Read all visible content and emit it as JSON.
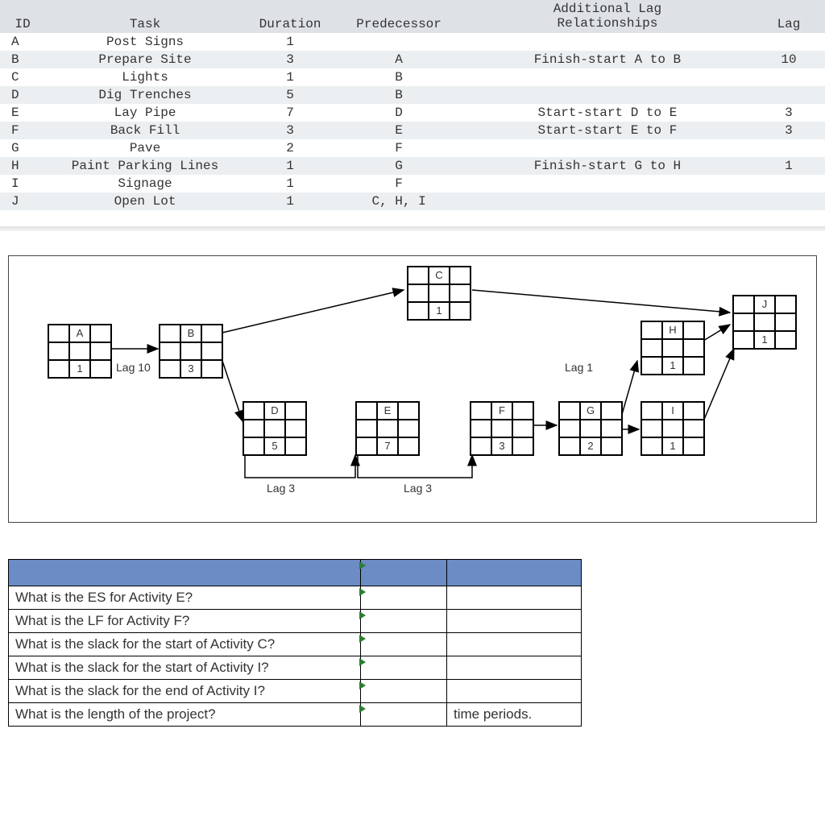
{
  "table": {
    "headers": {
      "id": "ID",
      "task": "Task",
      "duration": "Duration",
      "predecessor": "Predecessor",
      "lag_rel_line1": "Additional Lag",
      "lag_rel_line2": "Relationships",
      "lag": "Lag"
    },
    "rows": [
      {
        "id": "A",
        "task": "Post Signs",
        "duration": "1",
        "pred": "",
        "lag_rel": "",
        "lag": ""
      },
      {
        "id": "B",
        "task": "Prepare Site",
        "duration": "3",
        "pred": "A",
        "lag_rel": "Finish-start A to B",
        "lag": "10"
      },
      {
        "id": "C",
        "task": "Lights",
        "duration": "1",
        "pred": "B",
        "lag_rel": "",
        "lag": ""
      },
      {
        "id": "D",
        "task": "Dig Trenches",
        "duration": "5",
        "pred": "B",
        "lag_rel": "",
        "lag": ""
      },
      {
        "id": "E",
        "task": "Lay Pipe",
        "duration": "7",
        "pred": "D",
        "lag_rel": "Start-start D to E",
        "lag": "3"
      },
      {
        "id": "F",
        "task": "Back Fill",
        "duration": "3",
        "pred": "E",
        "lag_rel": "Start-start E to F",
        "lag": "3"
      },
      {
        "id": "G",
        "task": "Pave",
        "duration": "2",
        "pred": "F",
        "lag_rel": "",
        "lag": ""
      },
      {
        "id": "H",
        "task": "Paint Parking Lines",
        "duration": "1",
        "pred": "G",
        "lag_rel": "Finish-start G to H",
        "lag": "1"
      },
      {
        "id": "I",
        "task": "Signage",
        "duration": "1",
        "pred": "F",
        "lag_rel": "",
        "lag": ""
      },
      {
        "id": "J",
        "task": "Open Lot",
        "duration": "1",
        "pred": "C, H, I",
        "lag_rel": "",
        "lag": ""
      }
    ]
  },
  "diagram": {
    "nodes": {
      "A": {
        "id": "A",
        "dur": "1"
      },
      "B": {
        "id": "B",
        "dur": "3"
      },
      "C": {
        "id": "C",
        "dur": "1"
      },
      "D": {
        "id": "D",
        "dur": "5"
      },
      "E": {
        "id": "E",
        "dur": "7"
      },
      "F": {
        "id": "F",
        "dur": "3"
      },
      "G": {
        "id": "G",
        "dur": "2"
      },
      "H": {
        "id": "H",
        "dur": "1"
      },
      "I": {
        "id": "I",
        "dur": "1"
      },
      "J": {
        "id": "J",
        "dur": "1"
      }
    },
    "labels": {
      "lag10": "Lag 10",
      "lag3a": "Lag 3",
      "lag3b": "Lag 3",
      "lag1": "Lag  1"
    }
  },
  "questions": {
    "rows": [
      {
        "q": "What is the ES for Activity E?",
        "extra": ""
      },
      {
        "q": "What is the LF for Activity F?",
        "extra": ""
      },
      {
        "q": "What is the slack for the start of Activity C?",
        "extra": ""
      },
      {
        "q": "What is the slack for the start of Activity I?",
        "extra": ""
      },
      {
        "q": "What is the slack for the end of Activity I?",
        "extra": ""
      },
      {
        "q": "What is the length of the project?",
        "extra": "time periods."
      }
    ]
  }
}
